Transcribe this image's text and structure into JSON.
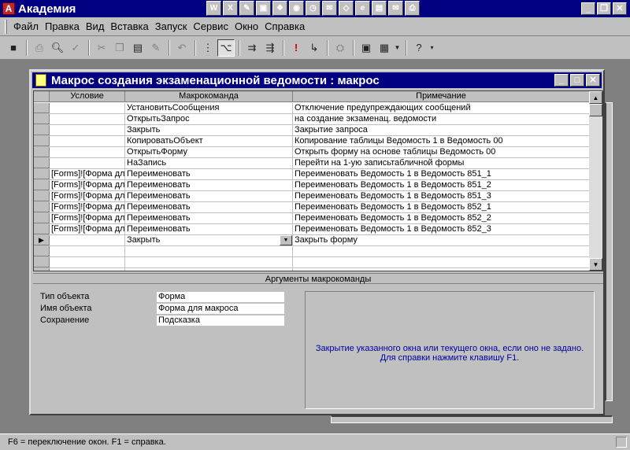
{
  "app": {
    "title": "Академия",
    "icon_letter": "A"
  },
  "office_bar": {
    "buttons": [
      "W",
      "X",
      "✎",
      "▣",
      "❖",
      "◉",
      "◷",
      "✉",
      "◇",
      "e",
      "▤",
      "✉",
      "⎙"
    ]
  },
  "menu": [
    {
      "label": "Файл"
    },
    {
      "label": "Правка"
    },
    {
      "label": "Вид"
    },
    {
      "label": "Вставка"
    },
    {
      "label": "Запуск"
    },
    {
      "label": "Сервис"
    },
    {
      "label": "Окно"
    },
    {
      "label": "Справка"
    }
  ],
  "macro_window": {
    "title": "Макрос создания экзаменационной ведомости : макрос",
    "columns": {
      "condition": "Условие",
      "action": "Макрокоманда",
      "note": "Примечание"
    },
    "rows": [
      {
        "condition": "",
        "action": "УстановитьСообщения",
        "note": "Отключение предупреждающих сообщений"
      },
      {
        "condition": "",
        "action": "ОткрытьЗапрос",
        "note": " на создание экзаменац. ведомости"
      },
      {
        "condition": "",
        "action": "Закрыть",
        "note": "Закрытие запроса"
      },
      {
        "condition": "",
        "action": "КопироватьОбъект",
        "note": "Копирование таблицы Ведомость 1 в Ведомость 00"
      },
      {
        "condition": "",
        "action": "ОткрытьФорму",
        "note": "Открыть форму на основе таблицы Ведомость 00"
      },
      {
        "condition": "",
        "action": "НаЗапись",
        "note": "Перейти на 1-ую записьтабличной формы"
      },
      {
        "condition": "[Forms]![Форма дл",
        "action": "Переименовать",
        "note": "Переименовать Ведомость 1 в Ведомость 851_1"
      },
      {
        "condition": "[Forms]![Форма дл",
        "action": "Переименовать",
        "note": "Переименовать Ведомость 1 в Ведомость 851_2"
      },
      {
        "condition": "[Forms]![Форма дл",
        "action": "Переименовать",
        "note": "Переименовать Ведомость 1 в Ведомость 851_3"
      },
      {
        "condition": "[Forms]![Форма дл",
        "action": "Переименовать",
        "note": "Переименовать Ведомость 1 в Ведомость 852_1"
      },
      {
        "condition": "[Forms]![Форма дл",
        "action": "Переименовать",
        "note": "Переименовать Ведомость 1 в Ведомость 852_2"
      },
      {
        "condition": "[Forms]![Форма дл",
        "action": "Переименовать",
        "note": "Переименовать Ведомость 1 в Ведомость 852_3"
      },
      {
        "condition": "",
        "action": "Закрыть",
        "note": "Закрыть форму",
        "current": true
      },
      {
        "condition": "",
        "action": "",
        "note": ""
      },
      {
        "condition": "",
        "action": "",
        "note": ""
      },
      {
        "condition": "",
        "action": "",
        "note": ""
      }
    ],
    "args_title": "Аргументы макрокоманды",
    "args": [
      {
        "label": "Тип объекта",
        "value": "Форма"
      },
      {
        "label": "Имя объекта",
        "value": "Форма для макроса"
      },
      {
        "label": "Сохранение",
        "value": "Подсказка"
      }
    ],
    "help_line1": "Закрытие указанного окна или текущего окна, если оно не задано.",
    "help_line2": "Для справки нажмите клавишу F1."
  },
  "status": {
    "text": "F6 = переключение окон.  F1 = справка."
  }
}
